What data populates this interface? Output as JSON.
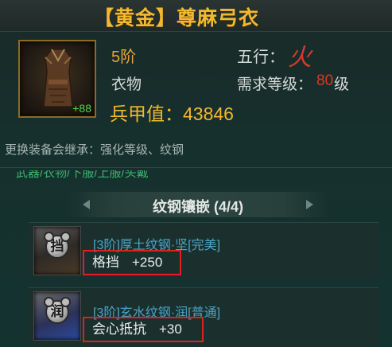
{
  "title": "【黄金】尊麻弓衣",
  "item": {
    "level_badge": "+88",
    "grade": "5阶",
    "category": "衣物",
    "power_label": "兵甲值：",
    "power_value": "43846"
  },
  "attrs": {
    "wuxing_label": "五行：",
    "wuxing_value": "火",
    "req_label": "需求等级：",
    "req_value": "80",
    "req_unit": "级"
  },
  "inherit_note": "更换装备会继承：强化等级、纹钢",
  "tabs": "武器/衣物/下服/上服/头戴",
  "section": {
    "title": "纹钢镶嵌 (4/4)"
  },
  "gems": [
    {
      "icon_char": "挡",
      "name": "[3阶]厚土纹钢·坚[完美]",
      "stat": "格挡",
      "value": "+250"
    },
    {
      "icon_char": "润",
      "name": "[3阶]玄水纹钢·润[普通]",
      "stat": "会心抵抗",
      "value": "+30"
    }
  ],
  "colors": {
    "title_gold": "#f2b930",
    "level_green": "#4fd84a",
    "fire_red": "#d83a2c",
    "gem_name_blue": "#4aa3c8",
    "highlight_box": "#e02020"
  }
}
